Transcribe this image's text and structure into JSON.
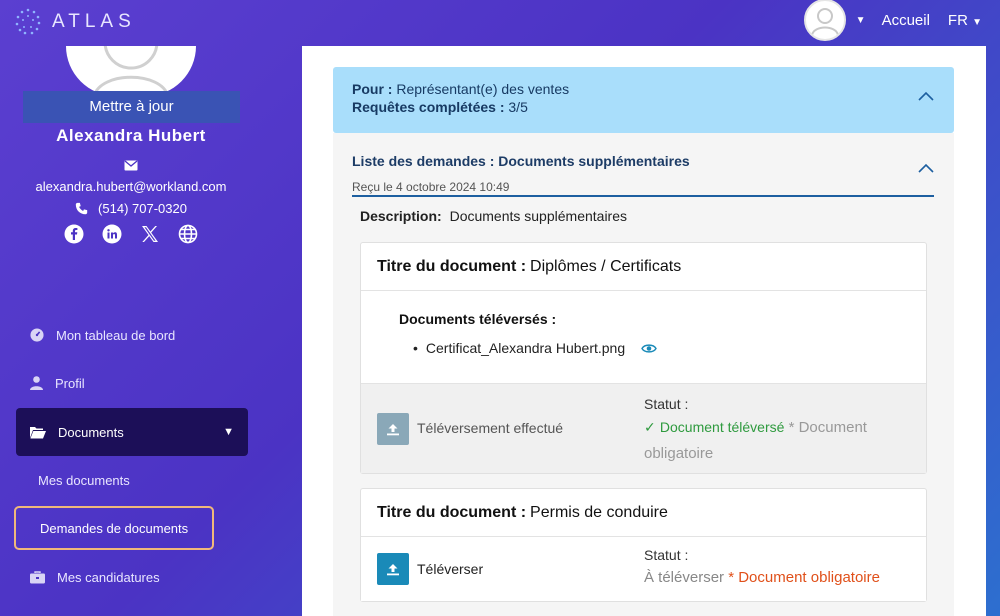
{
  "brand": {
    "name": "ATLAS"
  },
  "nav": {
    "home": "Accueil",
    "language": "FR"
  },
  "profile": {
    "update_label": "Mettre à jour",
    "name": "Alexandra  Hubert",
    "email": "alexandra.hubert@workland.com",
    "phone": "(514) 707-0320",
    "socials": [
      "facebook-icon",
      "linkedin-icon",
      "x-icon",
      "globe-icon"
    ]
  },
  "menu": {
    "dashboard": "Mon tableau de bord",
    "profile": "Profil",
    "documents": "Documents",
    "my_documents": "Mes documents",
    "document_requests": "Demandes de documents",
    "applications": "Mes candidatures"
  },
  "request": {
    "for_label": "Pour :",
    "for_value": "Représentant(e) des ventes",
    "completed_label": "Requêtes complétées :",
    "completed_value": "3/5"
  },
  "list": {
    "title": "Liste des demandes : Documents supplémentaires",
    "received": "Reçu le 4 octobre 2024 10:49",
    "description_label": "Description:",
    "description_value": "Documents supplémentaires"
  },
  "documents": [
    {
      "title_label": "Titre du document :",
      "title_value": "Diplômes / Certificats",
      "uploaded_label": "Documents téléversés :",
      "file_name": "Certificat_Alexandra Hubert.png",
      "action_label": "Téléversement effectué",
      "status_label": "Statut :",
      "status_value": "Document téléversé",
      "required_note": "* Document obligatoire"
    },
    {
      "title_label": "Titre du document :",
      "title_value": "Permis de conduire",
      "action_label": "Téléverser",
      "status_label": "Statut :",
      "status_value": "À téléverser",
      "required_note": "* Document obligatoire"
    }
  ],
  "colors": {
    "accent_dark": "#1c0f58",
    "request_card": "#a9defb",
    "success": "#2e9a3e",
    "required": "#e0501a",
    "upload_active": "#1a8ab8",
    "upload_done": "#8aa8b8"
  }
}
